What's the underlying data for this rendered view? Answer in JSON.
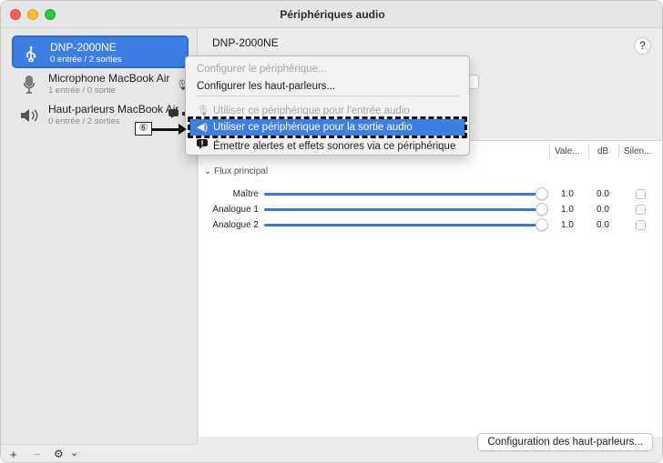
{
  "window": {
    "title": "Périphériques audio"
  },
  "sidebar": {
    "devices": [
      {
        "name": "DNP-2000NE",
        "sub": "0 entrée / 2 sorties",
        "icon": "usb-icon"
      },
      {
        "name": "Microphone MacBook Air",
        "sub": "1 entrée / 0 sortie",
        "icon": "microphone-icon"
      },
      {
        "name": "Haut-parleurs MacBook Air",
        "sub": "0 entrée / 2 sorties",
        "icon": "speaker-icon"
      }
    ],
    "footer": {
      "add": "+",
      "remove": "−",
      "gear": "⚙",
      "chevron": "⌄"
    }
  },
  "main": {
    "title": "DNP-2000NE",
    "help": "?",
    "columns": {
      "value": "Vale...",
      "db": "dB",
      "mute": "Silen..."
    },
    "group": "Flux principal",
    "group_chevron": "⌄",
    "channels": [
      {
        "label": "Maître",
        "value": "1.0",
        "db": "0.0",
        "level": 1.0,
        "muted": false
      },
      {
        "label": "Analogue 1",
        "value": "1.0",
        "db": "0.0",
        "level": 1.0,
        "muted": false
      },
      {
        "label": "Analogue 2",
        "value": "1.0",
        "db": "0.0",
        "level": 1.0,
        "muted": false
      }
    ],
    "config_button": "Configuration des haut-parleurs..."
  },
  "context_menu": {
    "items": [
      {
        "label": "Configurer le périphérique...",
        "enabled": false
      },
      {
        "label": "Configurer les haut-parleurs...",
        "enabled": true
      },
      {
        "label": "Utiliser ce périphérique pour l'entrée audio",
        "enabled": false,
        "icon": "microphone-icon"
      },
      {
        "label": "Utiliser ce périphérique pour la sortie audio",
        "enabled": true,
        "highlighted": true,
        "icon": "speaker-icon"
      },
      {
        "label": "Émettre alertes et effets sonores via ce périphérique",
        "enabled": true,
        "icon": "alert-icon"
      }
    ]
  },
  "annotation": {
    "callout": "⑥"
  },
  "colors": {
    "accent": "#3d7ee4",
    "slider": "#3a77d6"
  }
}
